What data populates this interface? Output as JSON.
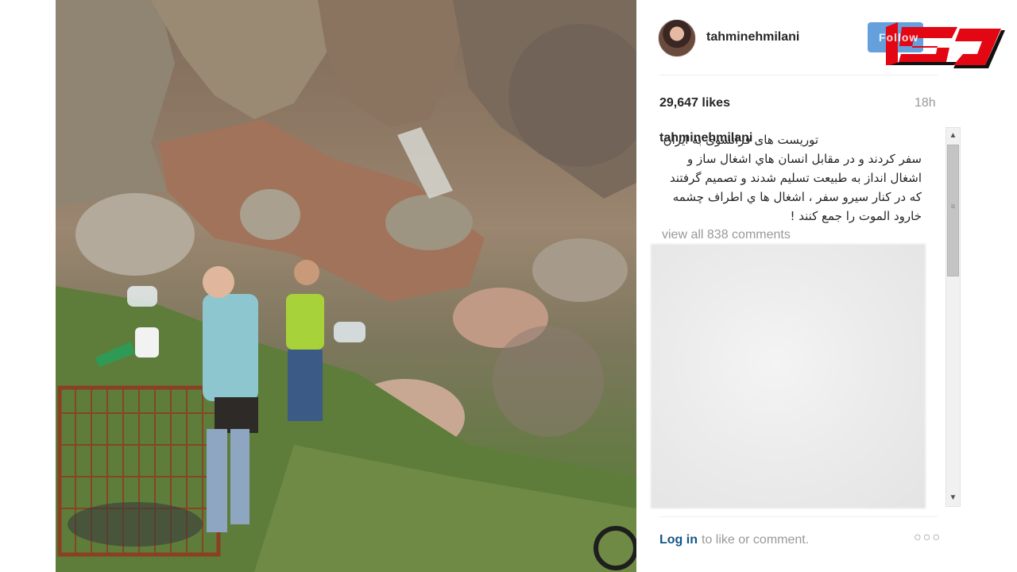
{
  "post": {
    "username": "tahminehmilani",
    "likes": "29,647 likes",
    "time": "18h",
    "caption_user": "tahminehmilani",
    "caption_text": "توریست های فرانسوی به ایران سفر کردند و در مقابل انسان هاي اشغال ساز و اشغال انداز به طبیعت تسلیم شدند و تصمیم گرفتند که در کنار سیرو سفر ، اشغال ها ي اطراف چشمه خارود الموت را جمع کنند !",
    "view_comments": "view all 838 comments"
  },
  "footer": {
    "login_link": "Log in",
    "login_rest": "to like or comment.",
    "more_icon": "more-options-icon"
  },
  "logo": {
    "word": "Follow"
  },
  "colors": {
    "link": "#125688",
    "muted": "#999999",
    "text": "#262626",
    "logo_red": "#e30613",
    "logo_black": "#111111"
  }
}
